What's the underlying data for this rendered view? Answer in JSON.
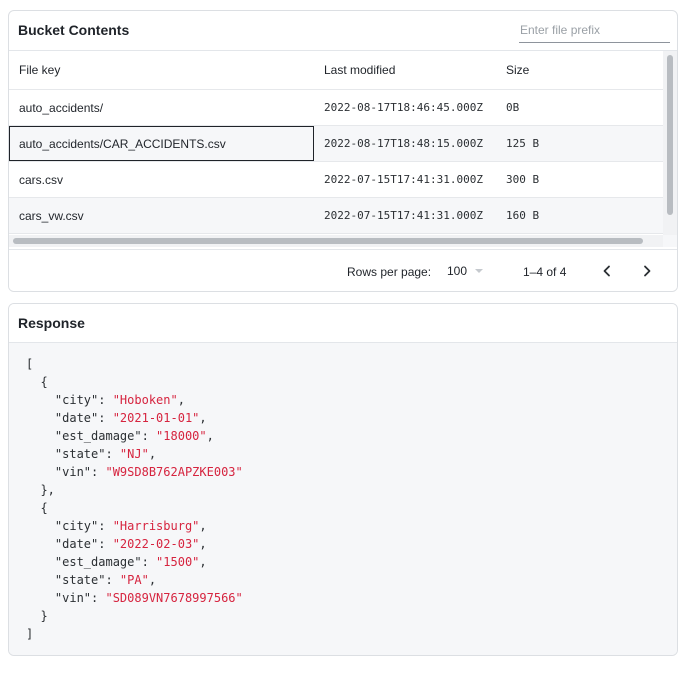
{
  "bucket": {
    "title": "Bucket Contents",
    "prefix_placeholder": "Enter file prefix",
    "prefix_value": "",
    "columns": [
      "File key",
      "Last modified",
      "Size"
    ],
    "rows": [
      {
        "key": "auto_accidents/",
        "modified": "2022-08-17T18:46:45.000Z",
        "size": "0B"
      },
      {
        "key": "auto_accidents/CAR_ACCIDENTS.csv",
        "modified": "2022-08-17T18:48:15.000Z",
        "size": "125 B"
      },
      {
        "key": "cars.csv",
        "modified": "2022-07-15T17:41:31.000Z",
        "size": "300 B"
      },
      {
        "key": "cars_vw.csv",
        "modified": "2022-07-15T17:41:31.000Z",
        "size": "160 B"
      }
    ],
    "selected_row": 1,
    "pagination": {
      "rows_per_page_label": "Rows per page:",
      "rows_per_page": "100",
      "range_text": "1–4 of 4",
      "prev_icon": "chevron-left-icon",
      "next_icon": "chevron-right-icon"
    }
  },
  "response": {
    "title": "Response",
    "records": [
      {
        "city": "Hoboken",
        "date": "2021-01-01",
        "est_damage": "18000",
        "state": "NJ",
        "vin": "W9SD8B762APZKE003"
      },
      {
        "city": "Harrisburg",
        "date": "2022-02-03",
        "est_damage": "1500",
        "state": "PA",
        "vin": "SD089VN7678997566"
      }
    ]
  },
  "colors": {
    "json_string": "#d6243f",
    "border": "#dcdfe3",
    "panel_bg": "#f6f7f9"
  }
}
